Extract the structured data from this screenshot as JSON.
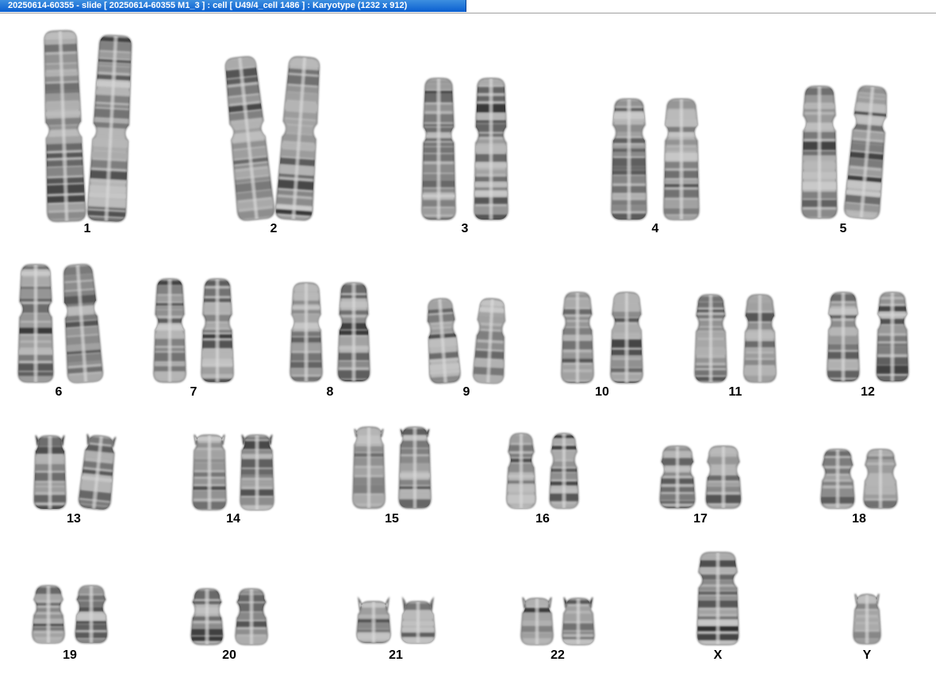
{
  "window": {
    "title": "20250614-60355 - slide [ 20250614-60355 M1_3 ] : cell [ U49/4_cell 1486 ] : Karyotype  (1232 x 912)"
  },
  "chromosomes": [
    {
      "label": "1"
    },
    {
      "label": "2"
    },
    {
      "label": "3"
    },
    {
      "label": "4"
    },
    {
      "label": "5"
    },
    {
      "label": "6"
    },
    {
      "label": "7"
    },
    {
      "label": "8"
    },
    {
      "label": "9"
    },
    {
      "label": "10"
    },
    {
      "label": "11"
    },
    {
      "label": "12"
    },
    {
      "label": "13"
    },
    {
      "label": "14"
    },
    {
      "label": "15"
    },
    {
      "label": "16"
    },
    {
      "label": "17"
    },
    {
      "label": "18"
    },
    {
      "label": "19"
    },
    {
      "label": "20"
    },
    {
      "label": "21"
    },
    {
      "label": "22"
    },
    {
      "label": "X"
    },
    {
      "label": "Y"
    }
  ]
}
